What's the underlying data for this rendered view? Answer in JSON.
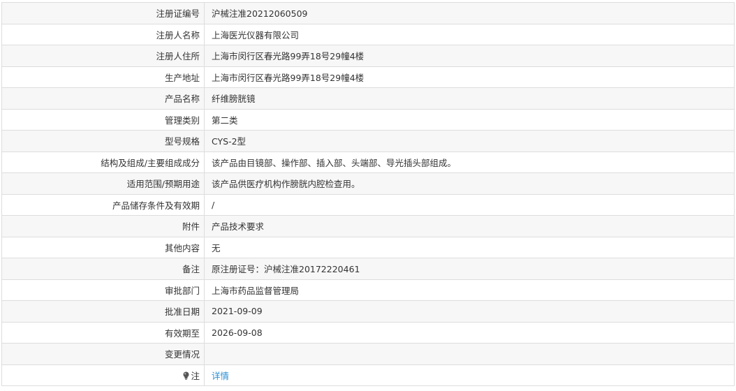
{
  "rows": [
    {
      "label": "注册证编号",
      "value": "沪械注准20212060509"
    },
    {
      "label": "注册人名称",
      "value": "上海医光仪器有限公司"
    },
    {
      "label": "注册人住所",
      "value": "上海市闵行区春光路99弄18号29幢4楼"
    },
    {
      "label": "生产地址",
      "value": "上海市闵行区春光路99弄18号29幢4楼"
    },
    {
      "label": "产品名称",
      "value": "纤维膀胱镜"
    },
    {
      "label": "管理类别",
      "value": "第二类"
    },
    {
      "label": "型号规格",
      "value": "CYS-2型"
    },
    {
      "label": "结构及组成/主要组成成分",
      "value": "该产品由目镜部、操作部、插入部、头端部、导光插头部组成。"
    },
    {
      "label": "适用范围/预期用途",
      "value": "该产品供医疗机构作膀胱内腔检查用。"
    },
    {
      "label": "产品储存条件及有效期",
      "value": "/"
    },
    {
      "label": "附件",
      "value": "产品技术要求"
    },
    {
      "label": "其他内容",
      "value": "无"
    },
    {
      "label": "备注",
      "value": "原注册证号：沪械注准20172220461"
    },
    {
      "label": "审批部门",
      "value": "上海市药品监督管理局"
    },
    {
      "label": "批准日期",
      "value": "2021-09-09"
    },
    {
      "label": "有效期至",
      "value": "2026-09-08"
    },
    {
      "label": "变更情况",
      "value": ""
    }
  ],
  "note_row": {
    "label": "注",
    "link": "详情",
    "icon": "lightbulb-icon"
  },
  "colors": {
    "link": "#2b8fd6",
    "border": "#dddddd",
    "stripe": "#f7f7f7"
  }
}
